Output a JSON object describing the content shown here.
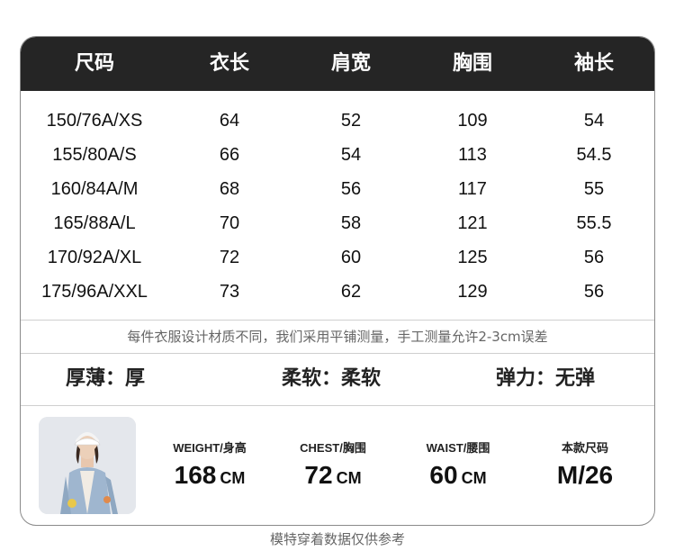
{
  "table": {
    "headers": [
      "尺码",
      "衣长",
      "肩宽",
      "胸围",
      "袖长"
    ],
    "rows": [
      [
        "150/76A/XS",
        "64",
        "52",
        "109",
        "54"
      ],
      [
        "155/80A/S",
        "66",
        "54",
        "113",
        "54.5"
      ],
      [
        "160/84A/M",
        "68",
        "56",
        "117",
        "55"
      ],
      [
        "165/88A/L",
        "70",
        "58",
        "121",
        "55.5"
      ],
      [
        "170/92A/XL",
        "72",
        "60",
        "125",
        "56"
      ],
      [
        "175/96A/XXL",
        "73",
        "62",
        "129",
        "56"
      ]
    ]
  },
  "note": "每件衣服设计材质不同，我们采用平铺测量，手工测量允许2-3cm误差",
  "properties": [
    {
      "label": "厚薄：",
      "value": "厚"
    },
    {
      "label": "柔软：",
      "value": "柔软"
    },
    {
      "label": "弹力：",
      "value": "无弹"
    }
  ],
  "model": {
    "weight": {
      "label": "WEIGHT/身高",
      "value": "168",
      "unit": "CM"
    },
    "chest": {
      "label": "CHEST/胸围",
      "value": "72",
      "unit": "CM"
    },
    "waist": {
      "label": "WAIST/腰围",
      "value": "60",
      "unit": "CM"
    },
    "size": {
      "label": "本款尺码",
      "value": "M/26"
    }
  },
  "footer": "模特穿着数据仅供参考",
  "colors": {
    "header_bg": "#252525",
    "header_text": "#ffffff",
    "border": "#8a8a8a"
  }
}
